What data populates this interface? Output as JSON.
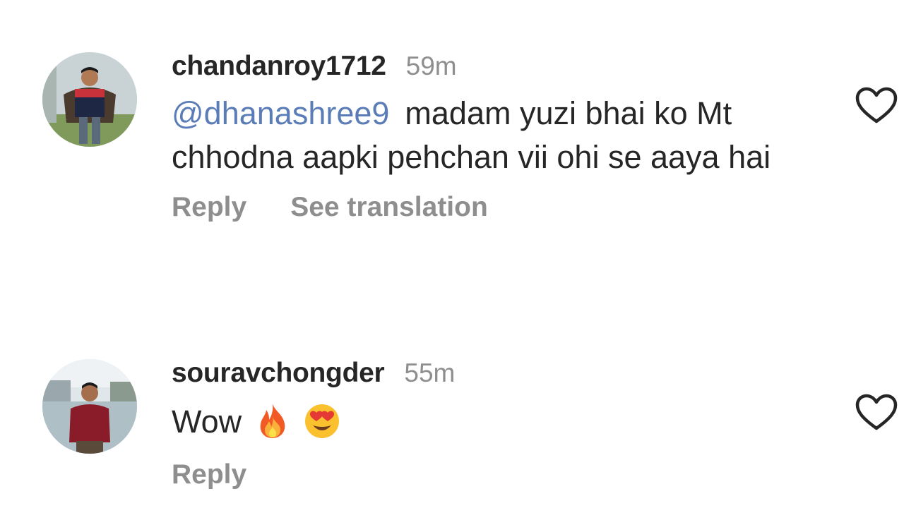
{
  "comments": [
    {
      "username": "chandanroy1712",
      "time": "59m",
      "mention": "@dhanashree9",
      "text": "madam yuzi bhai ko Mt chhodna aapki pehchan vii ohi se aaya hai",
      "actions": {
        "reply": "Reply",
        "translate": "See translation"
      },
      "avatar_icon": "user-avatar",
      "like_icon": "heart-outline-icon"
    },
    {
      "username": "souravchongder",
      "time": "55m",
      "text": "Wow",
      "emojis": [
        "fire-emoji",
        "heart-eyes-emoji"
      ],
      "actions": {
        "reply": "Reply"
      },
      "avatar_icon": "user-avatar",
      "like_icon": "heart-outline-icon"
    }
  ],
  "colors": {
    "username": "#262626",
    "secondary": "#8e8e8e",
    "mention": "#5b7db7",
    "background": "#ffffff"
  }
}
